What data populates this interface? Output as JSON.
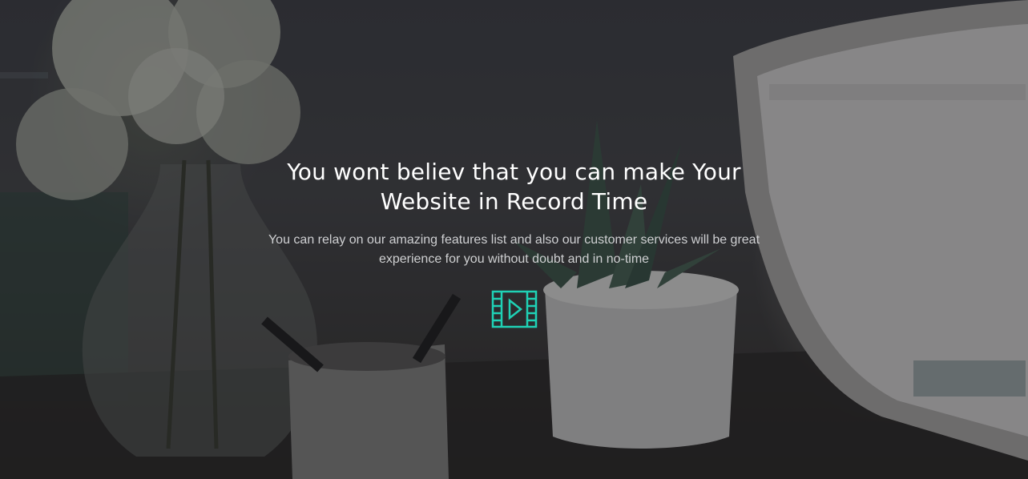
{
  "hero": {
    "title": "You wont believ that you can make Your Website in Record Time",
    "subtitle": "You can relay on our amazing features list and also our customer services will be great experience for you without doubt and in no-time",
    "video_button_icon": "film-play-icon",
    "accent_color": "#1fd1b5"
  }
}
